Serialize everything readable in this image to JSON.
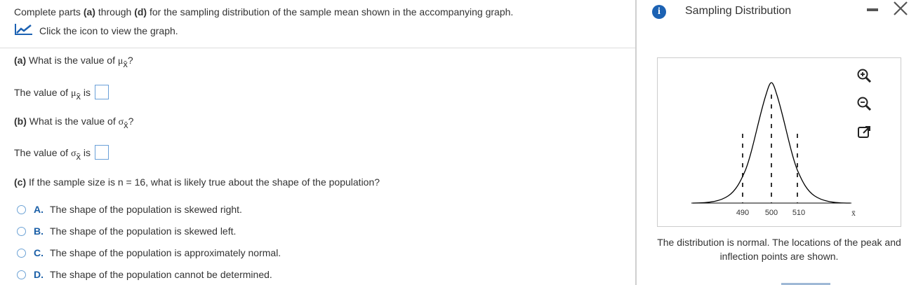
{
  "intro": {
    "text_pre": "Complete parts ",
    "part_a": "(a)",
    "text_mid": " through ",
    "part_d": "(d)",
    "text_post": " for the sampling distribution of the sample mean shown in the accompanying graph.",
    "graph_link_label": "Click the icon to view the graph."
  },
  "part_a": {
    "label": "(a)",
    "question_pre": " What is the value of ",
    "mu": "μ",
    "sub": "x̄",
    "question_post": "?",
    "answer_pre": "The value of ",
    "answer_post": " is",
    "answer_value": ""
  },
  "part_b": {
    "label": "(b)",
    "question_pre": " What is the value of ",
    "sigma": "σ",
    "sub": "x̄",
    "question_post": "?",
    "answer_pre": "The value of ",
    "answer_post": " is",
    "answer_value": ""
  },
  "part_c": {
    "label": "(c)",
    "question": " If the sample size is n = 16, what is likely true about the shape of the population?",
    "options": [
      {
        "letter": "A.",
        "text": "The shape of the population is skewed right."
      },
      {
        "letter": "B.",
        "text": "The shape of the population is skewed left."
      },
      {
        "letter": "C.",
        "text": "The shape of the population is approximately normal."
      },
      {
        "letter": "D.",
        "text": "The shape of the population cannot be determined."
      }
    ]
  },
  "panel": {
    "title": "Sampling Distribution",
    "info_icon": "i",
    "caption": "The distribution is normal. The locations of the peak and inflection points are shown.",
    "graph": {
      "ticks": [
        "490",
        "500",
        "510"
      ],
      "axis_label": "x̄"
    }
  },
  "colors": {
    "accent": "#1c62b3",
    "radio_border": "#6ea3d6",
    "option_letter": "#1a5fa7"
  }
}
